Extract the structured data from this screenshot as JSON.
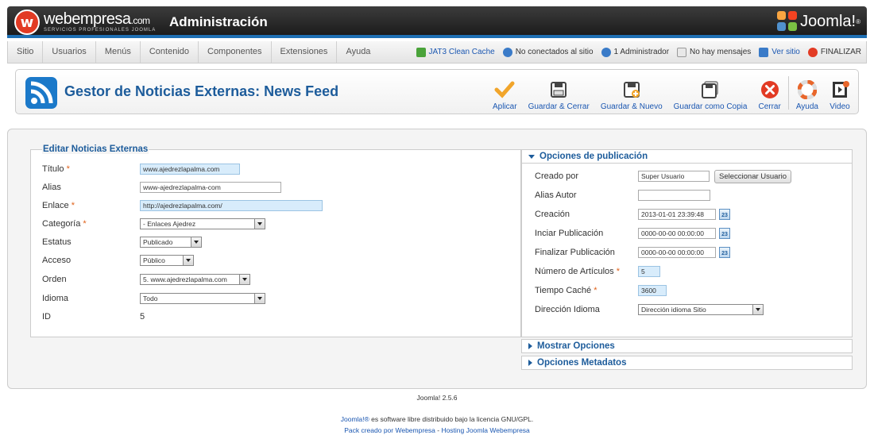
{
  "header": {
    "brand_name": "webempresa",
    "brand_suffix": ".com",
    "brand_subtitle": "SERVICIOS PROFESIONALES JOOMLA",
    "logo_glyph": "w",
    "title": "Administración",
    "joomla_logo": "Joomla!",
    "joomla_mark": "®"
  },
  "menu": {
    "items": [
      "Sitio",
      "Usuarios",
      "Menús",
      "Contenido",
      "Componentes",
      "Extensiones",
      "Ayuda"
    ],
    "status": {
      "cache": "JAT3 Clean Cache",
      "site": "No conectados al sitio",
      "admin": "1 Administrador",
      "messages": "No hay mensajes",
      "view": "Ver sitio",
      "logout": "FINALIZAR"
    }
  },
  "page": {
    "title": "Gestor de Noticias Externas: News Feed"
  },
  "toolbar": {
    "apply": "Aplicar",
    "save_close": "Guardar & Cerrar",
    "save_new": "Guardar & Nuevo",
    "save_copy": "Guardar como Copia",
    "close": "Cerrar",
    "help": "Ayuda",
    "video": "Video"
  },
  "form": {
    "legend": "Editar Noticias Externas",
    "required_mark": "*",
    "titulo": {
      "label": "Título",
      "value": "www.ajedrezlapalma.com"
    },
    "alias": {
      "label": "Alias",
      "value": "www-ajedrezlapalma-com"
    },
    "enlace": {
      "label": "Enlace",
      "value": "http://ajedrezlapalma.com/"
    },
    "categoria": {
      "label": "Categoría",
      "value": "- Enlaces Ajedrez"
    },
    "estatus": {
      "label": "Estatus",
      "value": "Publicado"
    },
    "acceso": {
      "label": "Acceso",
      "value": "Público"
    },
    "orden": {
      "label": "Orden",
      "value": "5. www.ajedrezlapalma.com"
    },
    "idioma": {
      "label": "Idioma",
      "value": "Todo"
    },
    "id": {
      "label": "ID",
      "value": "5"
    }
  },
  "publishing": {
    "title": "Opciones de publicación",
    "created_by": {
      "label": "Creado por",
      "value": "Super Usuario",
      "button": "Seleccionar Usuario"
    },
    "alias_author": {
      "label": "Alias Autor",
      "value": ""
    },
    "created": {
      "label": "Creación",
      "value": "2013-01-01 23:39:48"
    },
    "publish_up": {
      "label": "Inciar Publicación",
      "value": "0000-00-00 00:00:00"
    },
    "publish_down": {
      "label": "Finalizar Publicación",
      "value": "0000-00-00 00:00:00"
    },
    "num_articles": {
      "label": "Número de Artículos",
      "value": "5"
    },
    "cache_time": {
      "label": "Tiempo Caché",
      "value": "3600"
    },
    "language_direction": {
      "label": "Dirección Idioma",
      "value": "Dirección idioma Sitio"
    },
    "calendar_glyph": "23"
  },
  "panels": {
    "show_options": "Mostrar Opciones",
    "metadata_options": "Opciones Metadatos"
  },
  "footer": {
    "version": "Joomla! 2.5.6",
    "license_link": "Joomla!®",
    "license_text": " es software libre distribuido bajo la licencia GNU/GPL.",
    "pack_link": "Pack creado por Webempresa",
    "pack_sep": " - ",
    "hosting_link": "Hosting Joomla Webempresa"
  },
  "colors": {
    "accent": "#1d5c9b",
    "header_bar": "#1e6fb3",
    "required": "#e0611a"
  }
}
